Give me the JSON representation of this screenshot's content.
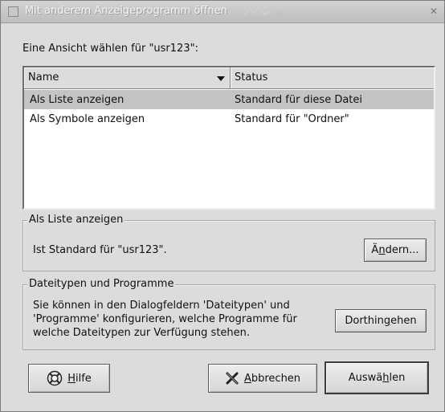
{
  "window": {
    "title": "Mit anderem Anzeigeprogramm öffnen"
  },
  "heading": "Eine Ansicht wählen für \"usr123\":",
  "list": {
    "columns": [
      "Name",
      "Status"
    ],
    "rows": [
      {
        "name": "Als Liste anzeigen",
        "status": "Standard für diese Datei",
        "selected": true
      },
      {
        "name": "Als Symbole anzeigen",
        "status": "Standard für \"Ordner\"",
        "selected": false
      }
    ]
  },
  "frame_view": {
    "legend": "Als Liste anzeigen",
    "text": "Ist Standard für \"usr123\".",
    "button": {
      "before": "Ä",
      "mnemonic": "n",
      "after": "dern..."
    }
  },
  "frame_types": {
    "legend": "Dateitypen und Programme",
    "lines": [
      "Sie können in den Dialogfeldern 'Dateitypen' und",
      "'Programme' konfigurieren, welche Programme für",
      "welche Dateitypen zur Verfügung stehen."
    ],
    "button": {
      "before": "Dorthin ",
      "mnemonic": "g",
      "after": "ehen"
    }
  },
  "buttons": {
    "help": {
      "before": "",
      "mnemonic": "H",
      "after": "ilfe",
      "icon": "help-lifebuoy-icon"
    },
    "cancel": {
      "before": "",
      "mnemonic": "A",
      "after": "bbrechen",
      "icon": "cancel-x-icon"
    },
    "select": {
      "before": "Auswä",
      "mnemonic": "h",
      "after": "len"
    }
  }
}
